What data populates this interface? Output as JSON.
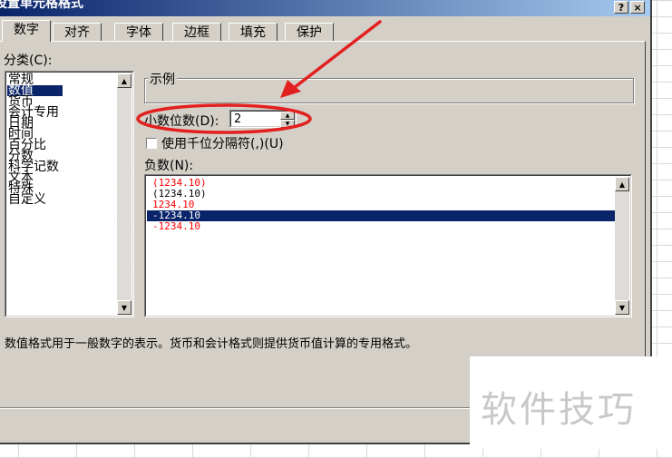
{
  "dialog": {
    "title": "设置单元格格式",
    "help_button": "?",
    "close_button": "×"
  },
  "tabs": [
    {
      "label": "数字",
      "active": true
    },
    {
      "label": "对齐",
      "active": false
    },
    {
      "label": "字体",
      "active": false
    },
    {
      "label": "边框",
      "active": false
    },
    {
      "label": "填充",
      "active": false
    },
    {
      "label": "保护",
      "active": false
    }
  ],
  "category": {
    "label": "分类(C):",
    "items": [
      "常规",
      "数值",
      "货币",
      "会计专用",
      "日期",
      "时间",
      "百分比",
      "分数",
      "科学记数",
      "文本",
      "特殊",
      "自定义"
    ],
    "selected": "数值"
  },
  "sample": {
    "label": "示例",
    "value": ""
  },
  "decimal_places": {
    "label": "小数位数(D):",
    "value": "2"
  },
  "thousands_separator": {
    "label": "使用千位分隔符(,)(U)",
    "checked": false
  },
  "negative_numbers": {
    "label": "负数(N):",
    "items": [
      {
        "text": "(1234.10)",
        "color": "#ff0000"
      },
      {
        "text": "(1234.10)",
        "color": "#000000"
      },
      {
        "text": "1234.10",
        "color": "#ff0000"
      },
      {
        "text": "-1234.10",
        "color": "#000000",
        "selected": true
      },
      {
        "text": "-1234.10",
        "color": "#ff0000"
      }
    ]
  },
  "description": "数值格式用于一般数字的表示。货币和会计格式则提供货币值计算的专用格式。",
  "watermark": "软件技巧",
  "colors": {
    "titlebar": "#0a246a",
    "selection": "#0a246a",
    "annotation_red": "#e32020",
    "dialog_face": "#d4d0c8"
  }
}
